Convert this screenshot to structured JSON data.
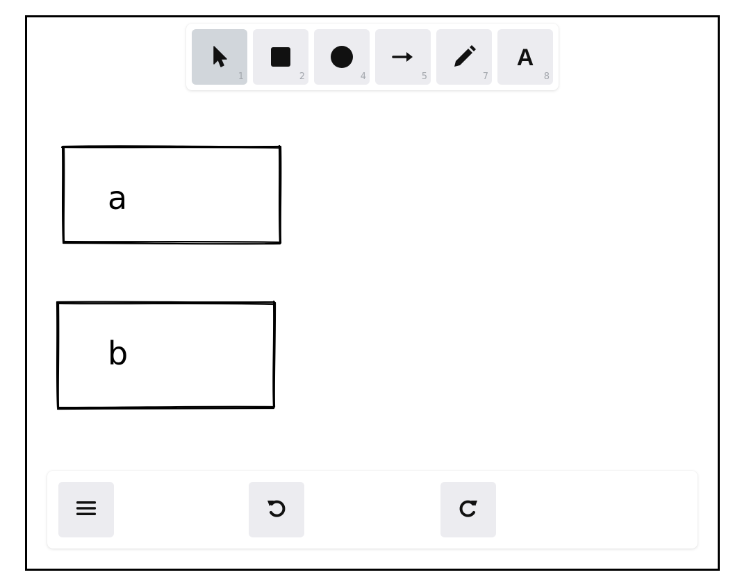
{
  "toolbar": {
    "tools": [
      {
        "name": "select",
        "icon": "pointer-icon",
        "shortcut": "1",
        "selected": true
      },
      {
        "name": "rectangle",
        "icon": "square-icon",
        "shortcut": "2",
        "selected": false
      },
      {
        "name": "ellipse",
        "icon": "circle-icon",
        "shortcut": "4",
        "selected": false
      },
      {
        "name": "arrow",
        "icon": "arrow-right-icon",
        "shortcut": "5",
        "selected": false
      },
      {
        "name": "draw",
        "icon": "pencil-icon",
        "shortcut": "7",
        "selected": false
      },
      {
        "name": "text",
        "icon": "text-icon",
        "glyph": "A",
        "shortcut": "8",
        "selected": false
      }
    ]
  },
  "canvas": {
    "shapes": [
      {
        "type": "rectangle",
        "label": "a"
      },
      {
        "type": "rectangle",
        "label": "b"
      }
    ]
  },
  "bottom_bar": {
    "menu": {
      "icon": "hamburger-menu-icon"
    },
    "undo": {
      "icon": "undo-icon"
    },
    "redo": {
      "icon": "redo-icon"
    }
  },
  "colors": {
    "tool_bg": "#ececf0",
    "tool_selected_bg": "#d1d6db",
    "stroke": "#000000"
  }
}
